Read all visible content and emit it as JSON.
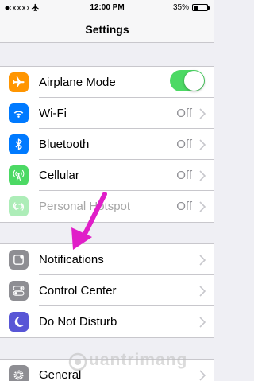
{
  "status_bar": {
    "time": "12:00 PM",
    "battery": "35%",
    "battery_level": 0.35
  },
  "nav": {
    "title": "Settings"
  },
  "group1": [
    {
      "name": "airplane-mode",
      "label": "Airplane Mode",
      "icon": "airplane-icon",
      "color": "#ff9500",
      "toggle": true
    },
    {
      "name": "wifi",
      "label": "Wi-Fi",
      "value": "Off",
      "icon": "wifi-icon",
      "color": "#007aff"
    },
    {
      "name": "bluetooth",
      "label": "Bluetooth",
      "value": "Off",
      "icon": "bluetooth-icon",
      "color": "#007aff"
    },
    {
      "name": "cellular",
      "label": "Cellular",
      "value": "Off",
      "icon": "antenna-icon",
      "color": "#4cd964"
    },
    {
      "name": "personal-hotspot",
      "label": "Personal Hotspot",
      "value": "Off",
      "icon": "hotspot-icon",
      "color": "#4cd964",
      "disabled": true
    }
  ],
  "group2": [
    {
      "name": "notifications",
      "label": "Notifications",
      "icon": "notifications-icon",
      "color": "#8e8e93"
    },
    {
      "name": "control-center",
      "label": "Control Center",
      "icon": "toggles-icon",
      "color": "#8e8e93"
    },
    {
      "name": "do-not-disturb",
      "label": "Do Not Disturb",
      "icon": "moon-icon",
      "color": "#5856d6"
    }
  ],
  "group3": [
    {
      "name": "general",
      "label": "General",
      "icon": "gear-icon",
      "color": "#8e8e93"
    }
  ],
  "annotation": {
    "arrow_color": "#e01ec8"
  },
  "watermark": {
    "text": "uantrimang"
  }
}
